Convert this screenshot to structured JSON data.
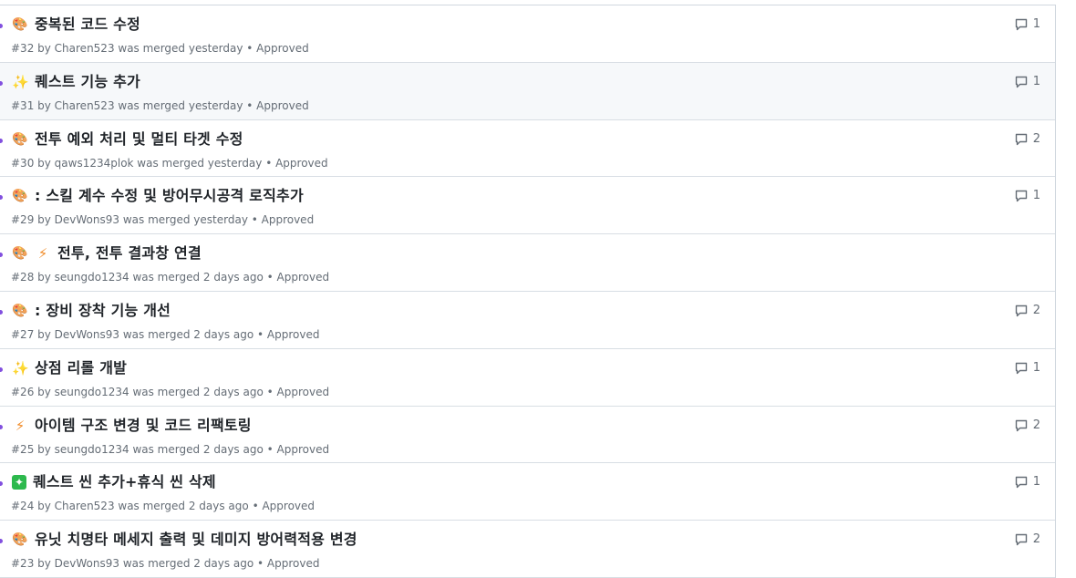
{
  "pull_requests": [
    {
      "emoji": "🎨",
      "emoji2": "",
      "title": "중복된 코드 수정",
      "meta": "#32 by Charen523 was merged yesterday • Approved",
      "comments": "1"
    },
    {
      "emoji": "✨",
      "emoji2": "",
      "title": "퀘스트 기능 추가",
      "meta": "#31 by Charen523 was merged yesterday • Approved",
      "comments": "1"
    },
    {
      "emoji": "🎨",
      "emoji2": "",
      "title": "전투 예외 처리 및 멀티 타겟 수정",
      "meta": "#30 by qaws1234plok was merged yesterday • Approved",
      "comments": "2"
    },
    {
      "emoji": "🎨",
      "emoji2": "",
      "title": ": 스킬 계수 수정 및 방어무시공격 로직추가",
      "meta": "#29 by DevWons93 was merged yesterday • Approved",
      "comments": "1"
    },
    {
      "emoji": "🎨",
      "emoji2": "⚡",
      "title": "전투, 전투 결과창 연결",
      "meta": "#28 by seungdo1234 was merged 2 days ago • Approved",
      "comments": ""
    },
    {
      "emoji": "🎨",
      "emoji2": "",
      "title": ": 장비 장착 기능 개선",
      "meta": "#27 by DevWons93 was merged 2 days ago • Approved",
      "comments": "2"
    },
    {
      "emoji": "✨",
      "emoji2": "",
      "title": "상점 리롤 개발",
      "meta": "#26 by seungdo1234 was merged 2 days ago • Approved",
      "comments": "1"
    },
    {
      "emoji": "⚡",
      "emoji2": "",
      "title": "아이템 구조 변경 및 코드 리팩토링",
      "meta": "#25 by seungdo1234 was merged 2 days ago • Approved",
      "comments": "2"
    },
    {
      "emoji": "✦",
      "emoji2": "",
      "title": "퀘스트 씬 추가+휴식 씬 삭제",
      "meta": "#24 by Charen523 was merged 2 days ago • Approved",
      "comments": "1"
    },
    {
      "emoji": "🎨",
      "emoji2": "",
      "title": "유닛 치명타 메세지 출력 및 데미지 방어력적용 변경",
      "meta": "#23 by DevWons93 was merged 2 days ago • Approved",
      "comments": "2"
    }
  ],
  "icons": {
    "palette": "art-palette-icon",
    "sparkles": "sparkles-icon",
    "zap": "zap-icon",
    "new": "sparkle-box-icon",
    "comment": "comment-icon"
  },
  "colors": {
    "merged_purple": "#8250df",
    "muted_text": "#656d76",
    "border": "#d0d7de"
  }
}
